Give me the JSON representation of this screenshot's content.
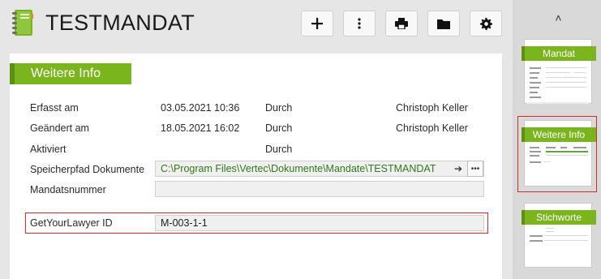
{
  "header": {
    "title": "TESTMANDAT",
    "buttons": [
      {
        "name": "add-button",
        "icon": "plus-icon"
      },
      {
        "name": "more-button",
        "icon": "kebab-icon"
      },
      {
        "name": "print-button",
        "icon": "printer-icon"
      },
      {
        "name": "folder-button",
        "icon": "folder-icon"
      },
      {
        "name": "settings-button",
        "icon": "gear-icon"
      }
    ]
  },
  "section": {
    "title": "Weitere Info"
  },
  "fields": {
    "erfasst": {
      "label": "Erfasst am",
      "value": "03.05.2021 10:36",
      "by_label": "Durch",
      "by_value": "Christoph Keller"
    },
    "geaendert": {
      "label": "Geändert am",
      "value": "18.05.2021 16:02",
      "by_label": "Durch",
      "by_value": "Christoph Keller"
    },
    "aktiviert": {
      "label": "Aktiviert",
      "value": "",
      "by_label": "Durch",
      "by_value": ""
    },
    "speicherpfad": {
      "label": "Speicherpfad Dokumente",
      "value": "C:\\Program Files\\Vertec\\Dokumente\\Mandate\\TESTMANDAT",
      "arrow": "➔",
      "more": "•••"
    },
    "mandatsnummer": {
      "label": "Mandatsnummer",
      "value": ""
    },
    "getyourlawyer": {
      "label": "GetYourLawyer ID",
      "value": "M-003-1-1"
    }
  },
  "sidebar": {
    "chevron": "˄",
    "pages": [
      {
        "label": "Mandat",
        "selected": false
      },
      {
        "label": "Weitere Info",
        "selected": true
      },
      {
        "label": "Stichworte",
        "selected": false
      }
    ]
  },
  "colors": {
    "accent": "#7ab51d",
    "highlight": "#d12b2b",
    "path_text": "#2f7a1a"
  }
}
